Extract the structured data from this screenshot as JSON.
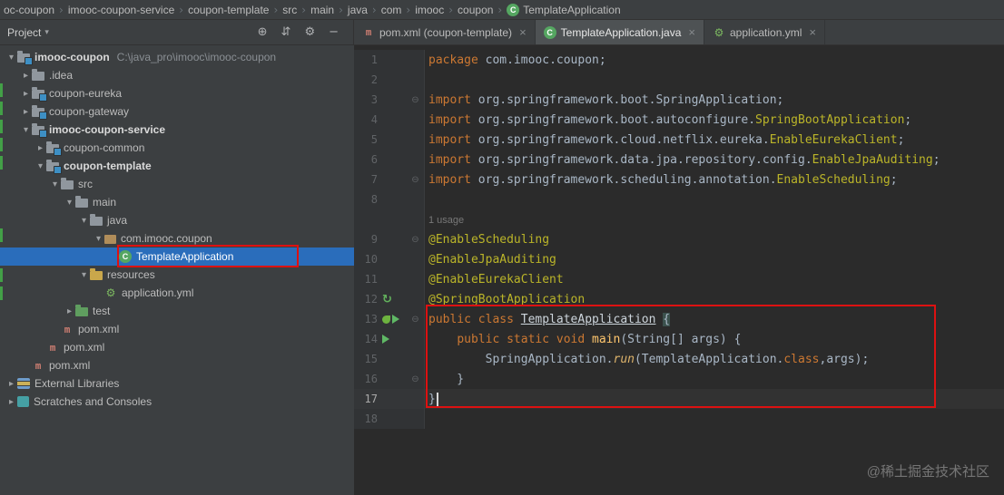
{
  "colors": {
    "accent_selection": "#2a6dbb",
    "editor_bg": "#2b2b2b",
    "panel_bg": "#3c3f41",
    "keyword": "#cc7832",
    "annotation": "#bbb529",
    "red_annotation_box": "#dd1111",
    "run_green": "#5fb865"
  },
  "navbar": {
    "items": [
      "oc-coupon",
      "imooc-coupon-service",
      "coupon-template",
      "src",
      "main",
      "java",
      "com",
      "imooc",
      "coupon",
      "TemplateApplication"
    ]
  },
  "tabs": [
    {
      "label": "pom.xml (coupon-template)",
      "icon": "maven-icon",
      "active": false
    },
    {
      "label": "TemplateApplication.java",
      "icon": "java-class-icon",
      "active": true
    },
    {
      "label": "application.yml",
      "icon": "spring-config-icon",
      "active": false
    }
  ],
  "project_panel": {
    "title": "Project",
    "toolbar_icons": [
      {
        "name": "locate-button",
        "glyph": "⊕"
      },
      {
        "name": "collapse-all-button",
        "glyph": "⇵"
      },
      {
        "name": "settings-button",
        "glyph": "⚙"
      },
      {
        "name": "hide-button",
        "glyph": "−"
      }
    ],
    "tree": [
      {
        "label": "imooc-coupon",
        "path": "C:\\java_pro\\imooc\\imooc-coupon",
        "level": 0,
        "chevron": "expanded",
        "icon": "module",
        "bold": true
      },
      {
        "label": ".idea",
        "level": 1,
        "chevron": "collapsed",
        "icon": "folder"
      },
      {
        "label": "coupon-eureka",
        "level": 1,
        "chevron": "collapsed",
        "icon": "module"
      },
      {
        "label": "coupon-gateway",
        "level": 1,
        "chevron": "collapsed",
        "icon": "module"
      },
      {
        "label": "imooc-coupon-service",
        "level": 1,
        "chevron": "expanded",
        "icon": "module",
        "bold": true
      },
      {
        "label": "coupon-common",
        "level": 2,
        "chevron": "collapsed",
        "icon": "module"
      },
      {
        "label": "coupon-template",
        "level": 2,
        "chevron": "expanded",
        "icon": "module",
        "bold": true
      },
      {
        "label": "src",
        "level": 3,
        "chevron": "expanded",
        "icon": "folder"
      },
      {
        "label": "main",
        "level": 4,
        "chevron": "expanded",
        "icon": "folder"
      },
      {
        "label": "java",
        "level": 5,
        "chevron": "expanded",
        "icon": "folder"
      },
      {
        "label": "com.imooc.coupon",
        "level": 6,
        "chevron": "expanded",
        "icon": "package"
      },
      {
        "label": "TemplateApplication",
        "level": 7,
        "icon": "class",
        "selected": true
      },
      {
        "label": "resources",
        "level": 5,
        "chevron": "expanded",
        "icon": "folder-resources"
      },
      {
        "label": "application.yml",
        "level": 6,
        "icon": "yml"
      },
      {
        "label": "test",
        "level": 4,
        "chevron": "collapsed",
        "icon": "folder-test"
      },
      {
        "label": "pom.xml",
        "level": 3,
        "icon": "maven"
      },
      {
        "label": "pom.xml",
        "level": 2,
        "icon": "maven"
      },
      {
        "label": "pom.xml",
        "level": 1,
        "icon": "maven"
      },
      {
        "label": "External Libraries",
        "level": 0,
        "chevron": "collapsed",
        "icon": "libraries"
      },
      {
        "label": "Scratches and Consoles",
        "level": 0,
        "chevron": "collapsed",
        "icon": "scratches"
      }
    ]
  },
  "editor": {
    "lines": [
      {
        "num": "1",
        "segs": [
          [
            "kw",
            "package"
          ],
          [
            "pl",
            " com.imooc.coupon;"
          ]
        ]
      },
      {
        "num": "2",
        "segs": []
      },
      {
        "num": "3",
        "fold": true,
        "segs": [
          [
            "kw",
            "import"
          ],
          [
            "pl",
            " org.springframework.boot.SpringApplication;"
          ]
        ]
      },
      {
        "num": "4",
        "segs": [
          [
            "kw",
            "import"
          ],
          [
            "pl",
            " org.springframework.boot.autoconfigure."
          ],
          [
            "ann",
            "SpringBootApplication"
          ],
          [
            "pl",
            ";"
          ]
        ]
      },
      {
        "num": "5",
        "segs": [
          [
            "kw",
            "import"
          ],
          [
            "pl",
            " org.springframework.cloud.netflix.eureka."
          ],
          [
            "ann",
            "EnableEurekaClient"
          ],
          [
            "pl",
            ";"
          ]
        ]
      },
      {
        "num": "6",
        "segs": [
          [
            "kw",
            "import"
          ],
          [
            "pl",
            " org.springframework.data.jpa.repository.config."
          ],
          [
            "ann",
            "EnableJpaAuditing"
          ],
          [
            "pl",
            ";"
          ]
        ]
      },
      {
        "num": "7",
        "fold": true,
        "segs": [
          [
            "kw",
            "import"
          ],
          [
            "pl",
            " org.springframework.scheduling.annotation."
          ],
          [
            "ann",
            "EnableScheduling"
          ],
          [
            "pl",
            ";"
          ]
        ]
      },
      {
        "num": "8",
        "segs": []
      },
      {
        "inlay": "1 usage"
      },
      {
        "num": "9",
        "fold": true,
        "segs": [
          [
            "ann",
            "@EnableScheduling"
          ]
        ]
      },
      {
        "num": "10",
        "segs": [
          [
            "ann",
            "@EnableJpaAuditing"
          ]
        ]
      },
      {
        "num": "11",
        "segs": [
          [
            "ann",
            "@EnableEurekaClient"
          ]
        ]
      },
      {
        "num": "12",
        "gutter": [
          "spring"
        ],
        "segs": [
          [
            "ann",
            "@SpringBootApplication"
          ]
        ]
      },
      {
        "num": "13",
        "gutter": [
          "leaf",
          "run"
        ],
        "fold": true,
        "segs": [
          [
            "kw",
            "public class "
          ],
          [
            "cls",
            "TemplateApplication"
          ],
          [
            "pl",
            " "
          ],
          [
            "brc",
            "{"
          ]
        ]
      },
      {
        "num": "14",
        "gutter": [
          "run"
        ],
        "segs": [
          [
            "pl",
            "    "
          ],
          [
            "kw",
            "public static void "
          ],
          [
            "mth",
            "main"
          ],
          [
            "pl",
            "(String[] args) {"
          ]
        ]
      },
      {
        "num": "15",
        "segs": [
          [
            "pl",
            "        SpringApplication."
          ],
          [
            "smi",
            "run"
          ],
          [
            "pl",
            "(TemplateApplication."
          ],
          [
            "kw",
            "class"
          ],
          [
            "pl",
            ",args);"
          ]
        ]
      },
      {
        "num": "16",
        "fold": true,
        "segs": [
          [
            "pl",
            "    }"
          ]
        ]
      },
      {
        "num": "17",
        "current": true,
        "caret": true,
        "segs": [
          [
            "pl",
            "}"
          ]
        ]
      },
      {
        "num": "18",
        "segs": []
      }
    ]
  },
  "watermark": "@稀土掘金技术社区"
}
